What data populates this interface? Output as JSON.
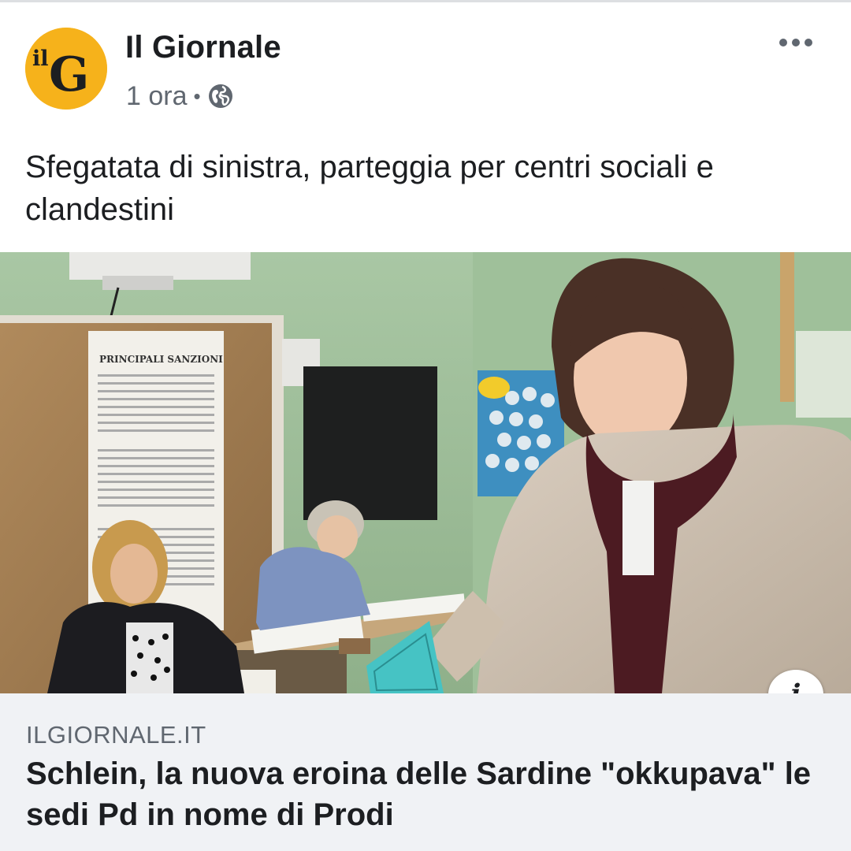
{
  "post": {
    "page_name": "Il Giornale",
    "time": "1 ora",
    "separator": "•",
    "privacy_icon": "globe-icon",
    "more_icon": "more-horizontal-icon",
    "text": "Sfegatata di sinistra, parteggia per centri sociali e clandestini",
    "avatar": {
      "logo_text_small": "il",
      "logo_text_large": "G",
      "background": "#f6b21b"
    }
  },
  "photo": {
    "poster_heading": "PRINCIPALI SANZIONI",
    "info_icon": "info-icon",
    "info_label": "i"
  },
  "link_preview": {
    "domain": "ILGIORNALE.IT",
    "title": "Schlein, la nuova eroina delle Sardine \"okkupava\" le sedi Pd in nome di Prodi"
  },
  "colors": {
    "text_primary": "#1c1e21",
    "text_secondary": "#606770",
    "link_background": "#f0f2f5"
  }
}
